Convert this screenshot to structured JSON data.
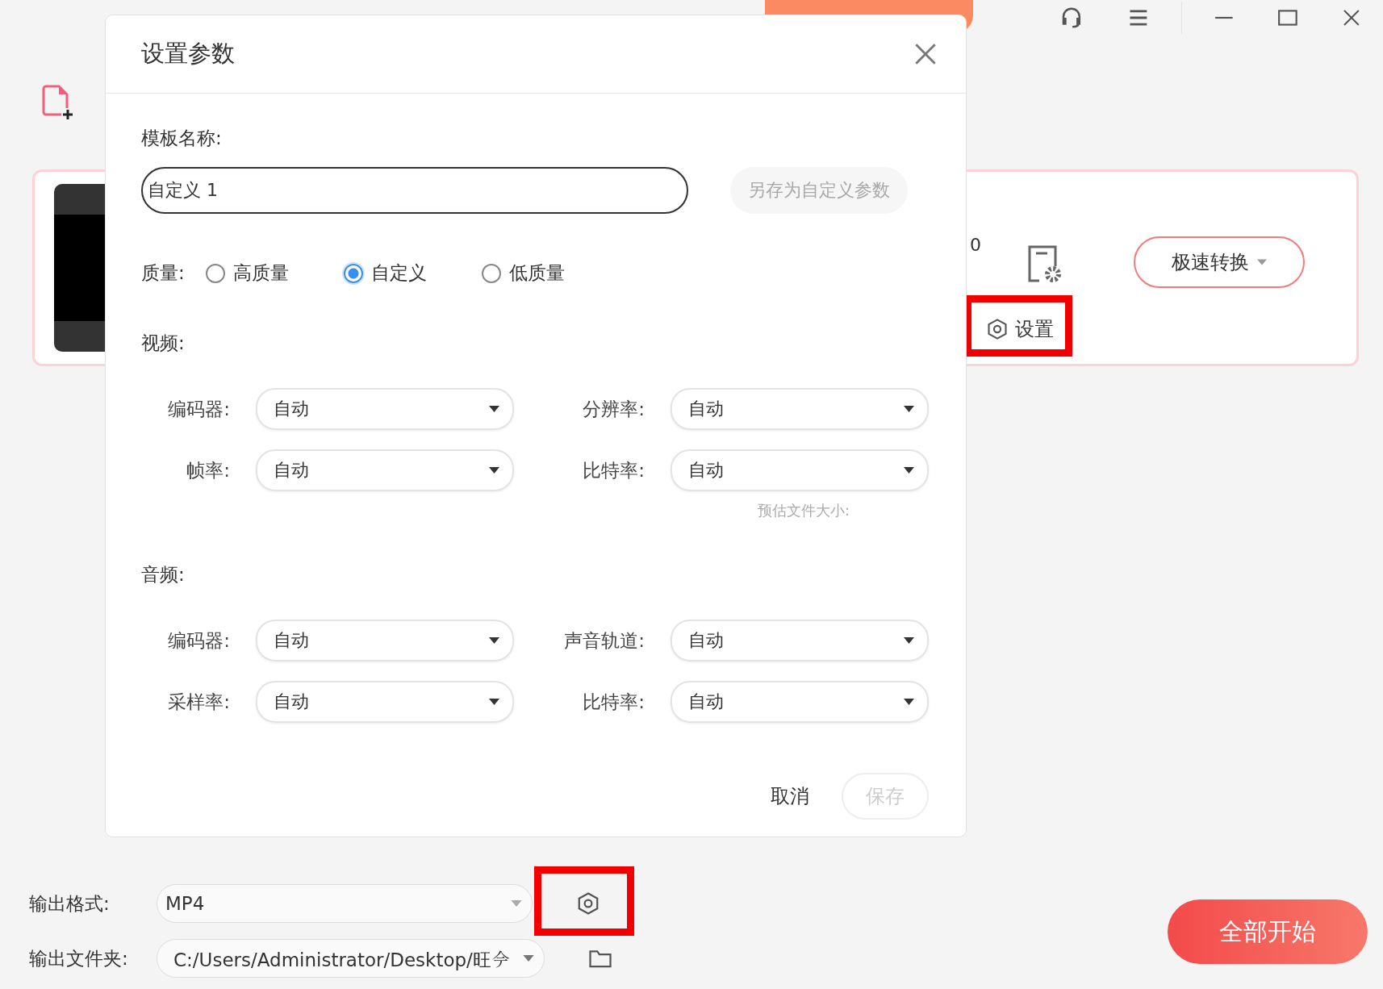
{
  "card": {
    "partial_text": "0",
    "settings_label": "设置",
    "convert_button": "极速转换"
  },
  "dialog": {
    "title": "设置参数",
    "template_label": "模板名称:",
    "template_value": "自定义 1",
    "save_as_button": {
      "label": "另存为自定义参数",
      "disabled": true
    },
    "quality_label": "质量:",
    "quality_options": [
      {
        "label": "高质量",
        "selected": false
      },
      {
        "label": "自定义",
        "selected": true
      },
      {
        "label": "低质量",
        "selected": false
      }
    ],
    "video_label": "视频:",
    "video_fields": [
      {
        "label": "编码器:",
        "value": "自动"
      },
      {
        "label": "分辨率:",
        "value": "自动"
      },
      {
        "label": "帧率:",
        "value": "自动"
      },
      {
        "label": "比特率:",
        "value": "自动"
      }
    ],
    "estimate_label": "预估文件大小:",
    "audio_label": "音频:",
    "audio_fields": [
      {
        "label": "编码器:",
        "value": "自动"
      },
      {
        "label": "声音轨道:",
        "value": "自动"
      },
      {
        "label": "采样率:",
        "value": "自动"
      },
      {
        "label": "比特率:",
        "value": "自动"
      }
    ],
    "cancel_button": {
      "label": "取消",
      "disabled": false
    },
    "save_button": {
      "label": "保存",
      "disabled": true
    }
  },
  "bottom": {
    "format_label": "输出格式:",
    "format_value": "MP4",
    "folder_label": "输出文件夹:",
    "folder_value": "C:/Users/Administrator/Desktop/旺𫝆",
    "start_button": "全部开始"
  }
}
